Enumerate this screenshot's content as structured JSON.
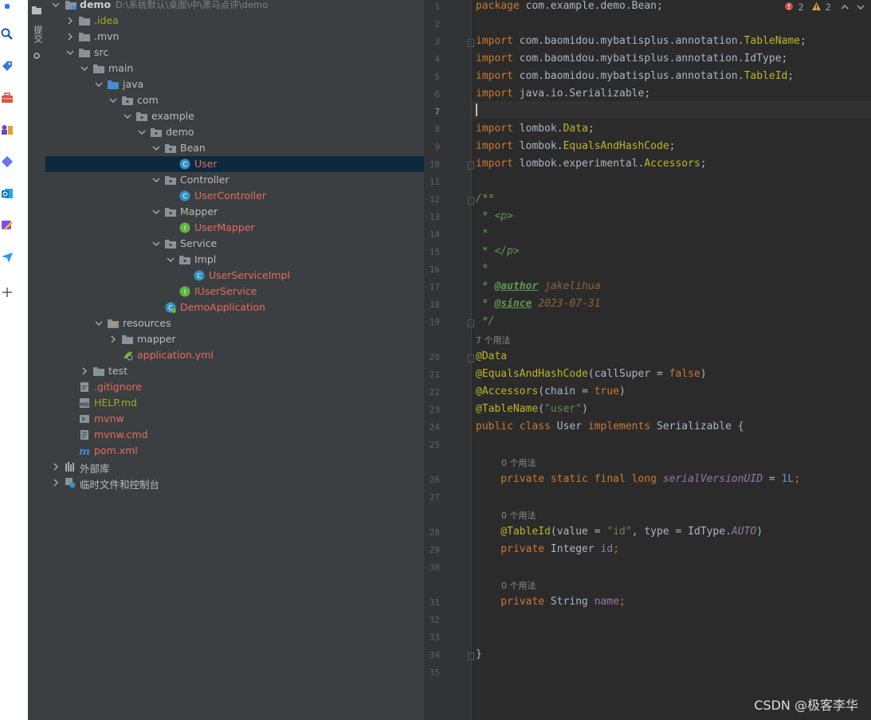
{
  "left_toolbar": {
    "commit_label": "提交",
    "icons": [
      "notification-icon",
      "search-icon",
      "tag-icon",
      "toolbox-icon",
      "chess-icon",
      "copilot-icon",
      "outlook-icon",
      "palette-icon",
      "send-icon",
      "add-icon"
    ]
  },
  "project": {
    "root_name": "demo",
    "root_path": "D:\\系统默认\\桌面\\中\\黑马点评\\demo",
    "items": [
      {
        "label": ".idea",
        "type": "folder",
        "indent": 1,
        "expanded": false,
        "color": "yellow"
      },
      {
        "label": ".mvn",
        "type": "folder",
        "indent": 1,
        "expanded": false,
        "color": "normal"
      },
      {
        "label": "src",
        "type": "folder",
        "indent": 1,
        "expanded": true,
        "color": "normal"
      },
      {
        "label": "main",
        "type": "folder",
        "indent": 2,
        "expanded": true,
        "color": "normal"
      },
      {
        "label": "java",
        "type": "source-folder",
        "indent": 3,
        "expanded": true,
        "color": "normal"
      },
      {
        "label": "com",
        "type": "package",
        "indent": 4,
        "expanded": true,
        "color": "normal"
      },
      {
        "label": "example",
        "type": "package",
        "indent": 5,
        "expanded": true,
        "color": "normal"
      },
      {
        "label": "demo",
        "type": "package",
        "indent": 6,
        "expanded": true,
        "color": "normal"
      },
      {
        "label": "Bean",
        "type": "package",
        "indent": 7,
        "expanded": true,
        "color": "normal"
      },
      {
        "label": "User",
        "type": "class",
        "indent": 8,
        "color": "red",
        "selected": true
      },
      {
        "label": "Controller",
        "type": "package",
        "indent": 7,
        "expanded": true,
        "color": "normal"
      },
      {
        "label": "UserController",
        "type": "class",
        "indent": 8,
        "color": "red"
      },
      {
        "label": "Mapper",
        "type": "package",
        "indent": 7,
        "expanded": true,
        "color": "normal"
      },
      {
        "label": "UserMapper",
        "type": "interface",
        "indent": 8,
        "color": "red"
      },
      {
        "label": "Service",
        "type": "package",
        "indent": 7,
        "expanded": true,
        "color": "normal"
      },
      {
        "label": "Impl",
        "type": "package",
        "indent": 8,
        "expanded": true,
        "color": "normal"
      },
      {
        "label": "UserServiceImpl",
        "type": "class",
        "indent": 9,
        "color": "red"
      },
      {
        "label": "IUserService",
        "type": "interface",
        "indent": 8,
        "color": "red"
      },
      {
        "label": "DemoApplication",
        "type": "spring-class",
        "indent": 7,
        "color": "red"
      },
      {
        "label": "resources",
        "type": "resources-folder",
        "indent": 3,
        "expanded": true,
        "color": "normal"
      },
      {
        "label": "mapper",
        "type": "folder",
        "indent": 4,
        "expanded": false,
        "color": "normal"
      },
      {
        "label": "application.yml",
        "type": "yml",
        "indent": 4,
        "color": "red"
      },
      {
        "label": "test",
        "type": "folder",
        "indent": 2,
        "expanded": false,
        "color": "normal"
      },
      {
        "label": ".gitignore",
        "type": "gitignore",
        "indent": 1,
        "color": "red"
      },
      {
        "label": "HELP.md",
        "type": "md",
        "indent": 1,
        "color": "yellow"
      },
      {
        "label": "mvnw",
        "type": "script",
        "indent": 1,
        "color": "red"
      },
      {
        "label": "mvnw.cmd",
        "type": "text",
        "indent": 1,
        "color": "red"
      },
      {
        "label": "pom.xml",
        "type": "maven",
        "indent": 1,
        "color": "red"
      },
      {
        "label": "外部库",
        "type": "libraries",
        "indent": 0,
        "expanded": false,
        "color": "normal"
      },
      {
        "label": "临时文件和控制台",
        "type": "scratches",
        "indent": 0,
        "expanded": false,
        "color": "normal"
      }
    ]
  },
  "editor": {
    "errors": "2",
    "warnings": "2",
    "usages_7": "7 个用法",
    "usages_0": "0 个用法",
    "line_numbers": [
      "1",
      "2",
      "3",
      "4",
      "5",
      "6",
      "7",
      "8",
      "9",
      "10",
      "11",
      "12",
      "13",
      "14",
      "15",
      "16",
      "17",
      "18",
      "19",
      "20",
      "21",
      "22",
      "23",
      "24",
      "25",
      "26",
      "27",
      "28",
      "29",
      "30",
      "31",
      "32",
      "33",
      "34",
      "35"
    ],
    "code": {
      "l1_kw": "package",
      "l1_rest": " com.example.demo.Bean;",
      "l3_kw": "import",
      "l3_pre": " com.baomidou.mybatisplus.annotation.",
      "l3_cls": "TableName",
      "l4_rest": " com.baomidou.mybatisplus.annotation.IdType;",
      "l5_pre": " com.baomidou.mybatisplus.annotation.",
      "l5_cls": "TableId",
      "l6_rest": " java.io.Serializable;",
      "l8_pre": " lombok.",
      "l8_cls": "Data",
      "l9_pre": " lombok.",
      "l9_cls": "EqualsAndHashCode",
      "l10_pre": " lombok.experimental.",
      "l10_cls": "Accessors",
      "l12": "/**",
      "l13": " * <p>",
      "l14": " *",
      "l15": " * </p>",
      "l16": " *",
      "l17_pre": " * ",
      "l17_tag": "@author",
      "l17_val": " jakelihua",
      "l18_pre": " * ",
      "l18_tag": "@since",
      "l18_val": " 2023-07-31",
      "l19": " */",
      "l20": "@Data",
      "l21_ann": "@EqualsAndHashCode",
      "l21_a": "(callSuper = ",
      "l21_kw": "false",
      "l21_b": ")",
      "l22_ann": "@Accessors",
      "l22_a": "(chain = ",
      "l22_kw": "true",
      "l22_b": ")",
      "l23_ann": "@TableName",
      "l23_a": "(",
      "l23_str": "\"user\"",
      "l23_b": ")",
      "l24_kw1": "public class",
      "l24_name": " User ",
      "l24_kw2": "implements",
      "l24_rest": " Serializable {",
      "l26_kw": "    private static final long ",
      "l26_fld": "serialVersionUID",
      "l26_eq": " = ",
      "l26_num": "1L",
      "l26_end": ";",
      "l28_ann": "    @TableId",
      "l28_a": "(value = ",
      "l28_str": "\"id\"",
      "l28_b": ", type = IdType.",
      "l28_const": "AUTO",
      "l28_c": ")",
      "l29_kw": "    private",
      "l29_type": " Integer ",
      "l29_fld": "id",
      "l29_end": ";",
      "l31_kw": "    private",
      "l31_type": " String ",
      "l31_fld": "name",
      "l31_end": ";",
      "l34": "}"
    }
  },
  "watermark": "CSDN @极客李华"
}
